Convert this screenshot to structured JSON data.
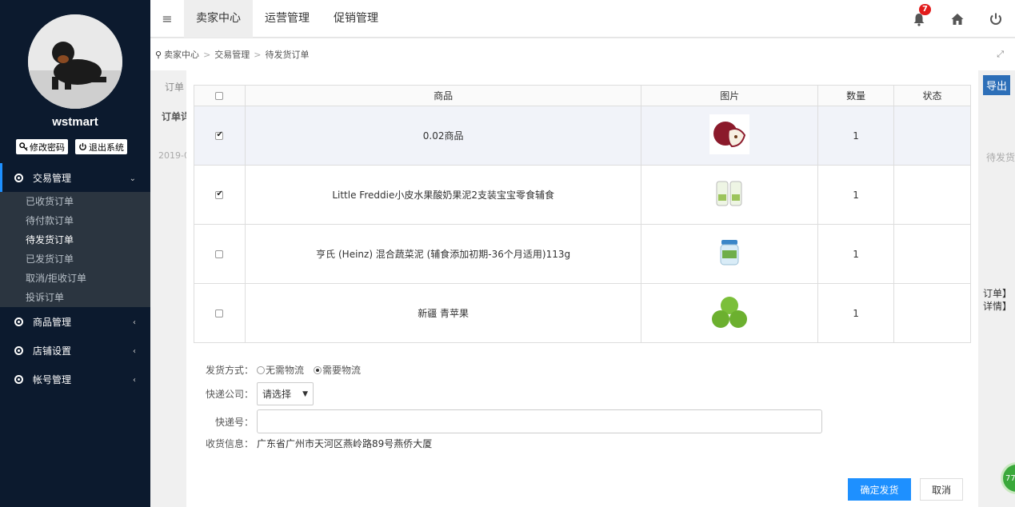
{
  "sidebar": {
    "username": "wstmart",
    "change_password": "修改密码",
    "logout": "退出系统",
    "groups": [
      {
        "label": "交易管理",
        "chevron": "⌄",
        "items": [
          "已收货订单",
          "待付款订单",
          "待发货订单",
          "已发货订单",
          "取消/拒收订单",
          "投诉订单"
        ]
      },
      {
        "label": "商品管理",
        "chevron": "‹"
      },
      {
        "label": "店铺设置",
        "chevron": "‹"
      },
      {
        "label": "帐号管理",
        "chevron": "‹"
      }
    ]
  },
  "topbar": {
    "menu_icon": "≡",
    "tabs": [
      "卖家中心",
      "运营管理",
      "促销管理"
    ],
    "notification_count": "7"
  },
  "breadcrumb": [
    "卖家中心",
    "交易管理",
    "待发货订单"
  ],
  "background": {
    "frag_order": "订单",
    "frag_order_detail": "订单详",
    "frag_date": "2019-0",
    "frag_status": "待发货",
    "frag_export": "导出",
    "frag_link1": "订单】",
    "frag_link2": "详情】",
    "chat_badge": "77"
  },
  "modal": {
    "table": {
      "headers": [
        "商品",
        "图片",
        "数量",
        "状态"
      ],
      "rows": [
        {
          "name": "0.02商品",
          "qty": "1",
          "status": "",
          "checked": true
        },
        {
          "name": "Little Freddie小皮水果酸奶果泥2支装宝宝零食辅食",
          "qty": "1",
          "status": "",
          "checked": true
        },
        {
          "name": "亨氏 (Heinz) 混合蔬菜泥 (辅食添加初期-36个月适用)113g",
          "qty": "1",
          "status": "",
          "checked": false
        },
        {
          "name": "新疆 青苹果",
          "qty": "1",
          "status": "",
          "checked": false
        }
      ]
    },
    "form": {
      "delivery_label": "发货方式：",
      "delivery_opt1": "无需物流",
      "delivery_opt2": "需要物流",
      "courier_label": "快递公司：",
      "courier_value": "请选择",
      "tracking_label": "快递号：",
      "tracking_value": "",
      "address_label": "收货信息：",
      "address_value": "广东省广州市天河区燕岭路89号燕侨大厦"
    },
    "confirm_button": "确定发货",
    "cancel_button": "取消"
  }
}
